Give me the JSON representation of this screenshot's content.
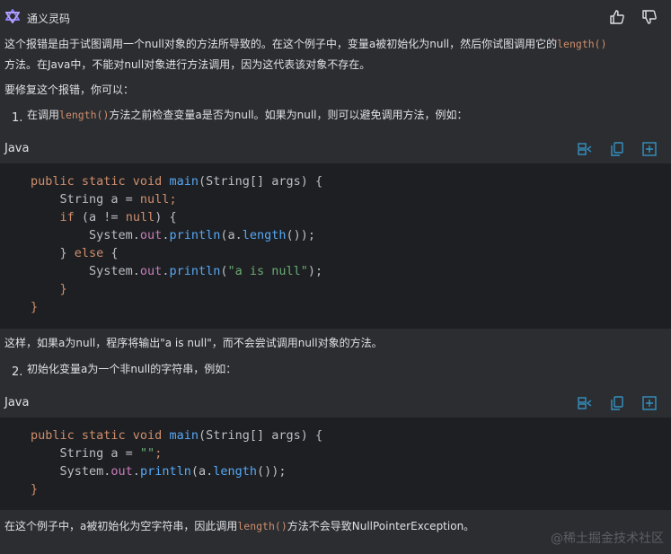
{
  "header": {
    "app_name": "通义灵码"
  },
  "intro": {
    "line1_a": "这个报错是由于试图调用一个null对象的方法所导致的。在这个例子中，变量a被初始化为null，然后你试图调用它的",
    "line1_code": "length()",
    "line2": "方法。在Java中，不能对null对象进行方法调用，因为这代表该对象不存在。",
    "fix_intro": "要修复这个报错，你可以："
  },
  "step1": {
    "number": "1.",
    "text_a": "在调用",
    "code": "length()",
    "text_b": "方法之前检查变量a是否为null。如果为null，则可以避免调用方法，例如："
  },
  "code_block_1": {
    "language": "Java",
    "lines": [
      [
        "public static void ",
        "main",
        "(String[] args) {"
      ],
      [
        "    String a = ",
        "null",
        ";"
      ],
      [
        "    if ",
        "(a != ",
        "null",
        ") {"
      ],
      [
        "        System.",
        "out",
        ".",
        "println",
        "(a.",
        "length",
        "());"
      ],
      [
        "    } ",
        "else",
        " {"
      ],
      [
        "        System.",
        "out",
        ".",
        "println",
        "(",
        "\"a is null\"",
        ");"
      ],
      [
        "    }"
      ],
      [
        "}"
      ]
    ]
  },
  "after1": {
    "text": "这样，如果a为null，程序将输出\"a is null\"，而不会尝试调用null对象的方法。"
  },
  "step2": {
    "number": "2.",
    "text": "初始化变量a为一个非null的字符串，例如："
  },
  "code_block_2": {
    "language": "Java"
  },
  "conclusion": {
    "text_a": "在这个例子中，a被初始化为空字符串，因此调用",
    "code": "length()",
    "text_b": "方法不会导致NullPointerException。"
  },
  "watermark": "@稀土掘金技术社区",
  "colors": {
    "background": "#2b2d30",
    "code_background": "#1e1f22",
    "keyword": "#cf8e6d",
    "function": "#56a8f5",
    "string": "#6aab73",
    "icon_accent": "#3592c4"
  },
  "icons": {
    "logo": "tongyi-logo-icon",
    "like": "thumbs-up-icon",
    "dislike": "thumbs-down-icon",
    "insert": "insert-code-icon",
    "copy": "copy-icon",
    "new_file": "new-file-icon"
  }
}
